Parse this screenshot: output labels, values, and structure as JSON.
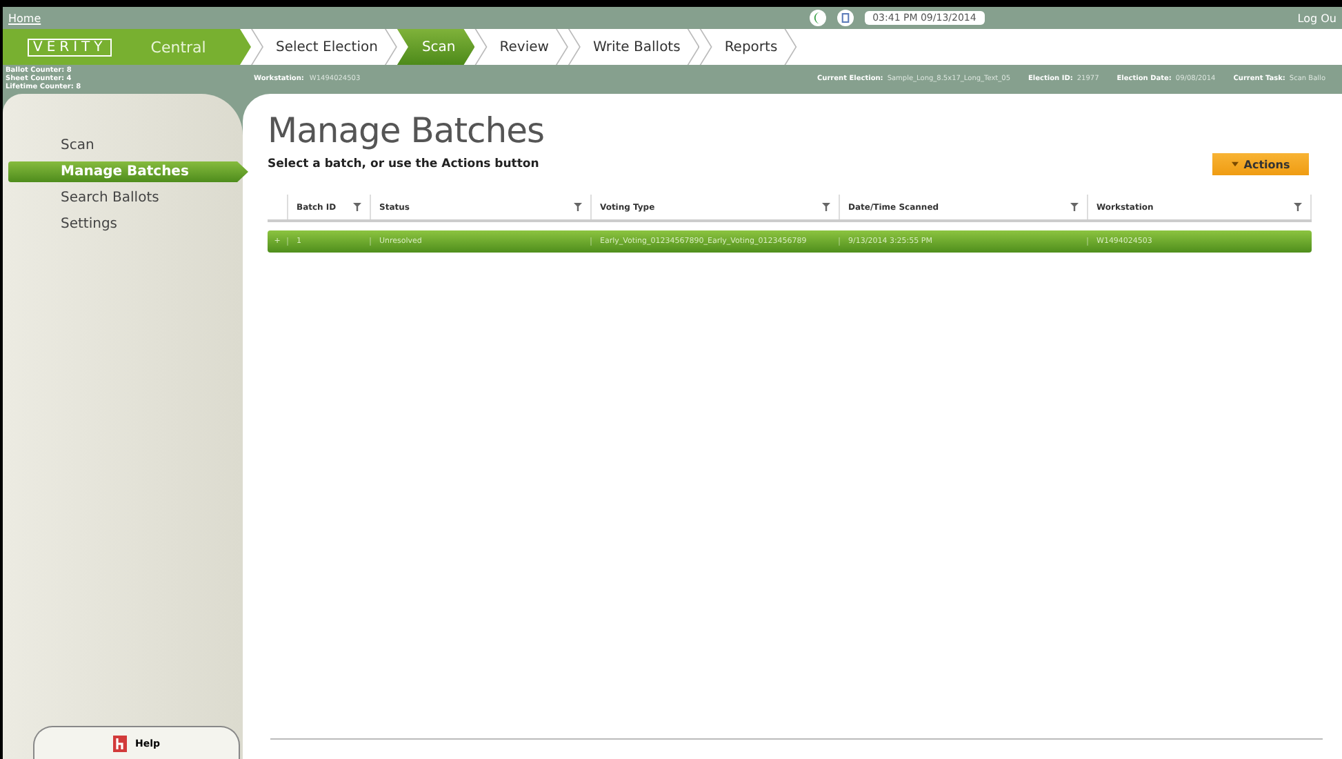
{
  "top_bar": {
    "home_link": "Home",
    "clock": "03:41 PM 09/13/2014",
    "logout_link": "Log Ou"
  },
  "brand": {
    "logo": "VERITY",
    "product": "Central"
  },
  "steps": [
    {
      "label": "Select Election",
      "selected": false
    },
    {
      "label": "Scan",
      "selected": true
    },
    {
      "label": "Review",
      "selected": false
    },
    {
      "label": "Write Ballots",
      "selected": false
    },
    {
      "label": "Reports",
      "selected": false
    }
  ],
  "counters": [
    "Ballot Counter: 8",
    "Sheet Counter: 4",
    "Lifetime Counter: 8"
  ],
  "info_bar": {
    "workstation_label": "Workstation:",
    "workstation": "W1494024503",
    "fields": [
      {
        "label": "Current Election:",
        "value": "Sample_Long_8.5x17_Long_Text_05"
      },
      {
        "label": "Election ID:",
        "value": "21977"
      },
      {
        "label": "Election Date:",
        "value": "09/08/2014"
      },
      {
        "label": "Current Task:",
        "value": "Scan Ballo"
      }
    ]
  },
  "sidebar": {
    "items": [
      {
        "label": "Scan",
        "selected": false
      },
      {
        "label": "Manage Batches",
        "selected": true
      },
      {
        "label": "Search Ballots",
        "selected": false
      },
      {
        "label": "Settings",
        "selected": false
      }
    ],
    "help_button": "Help"
  },
  "page": {
    "title": "Manage Batches",
    "subtitle": "Select a batch, or use the Actions button",
    "actions_button": "Actions"
  },
  "table": {
    "columns": [
      "Batch ID",
      "Status",
      "Voting Type",
      "Date/Time Scanned",
      "Workstation"
    ],
    "rows": [
      {
        "expander": "+",
        "selected": true,
        "cells": [
          "1",
          "Unresolved",
          "Early_Voting_01234567890_Early_Voting_0123456789",
          "9/13/2014 3:25:55 PM",
          "W1494024503"
        ]
      }
    ]
  }
}
